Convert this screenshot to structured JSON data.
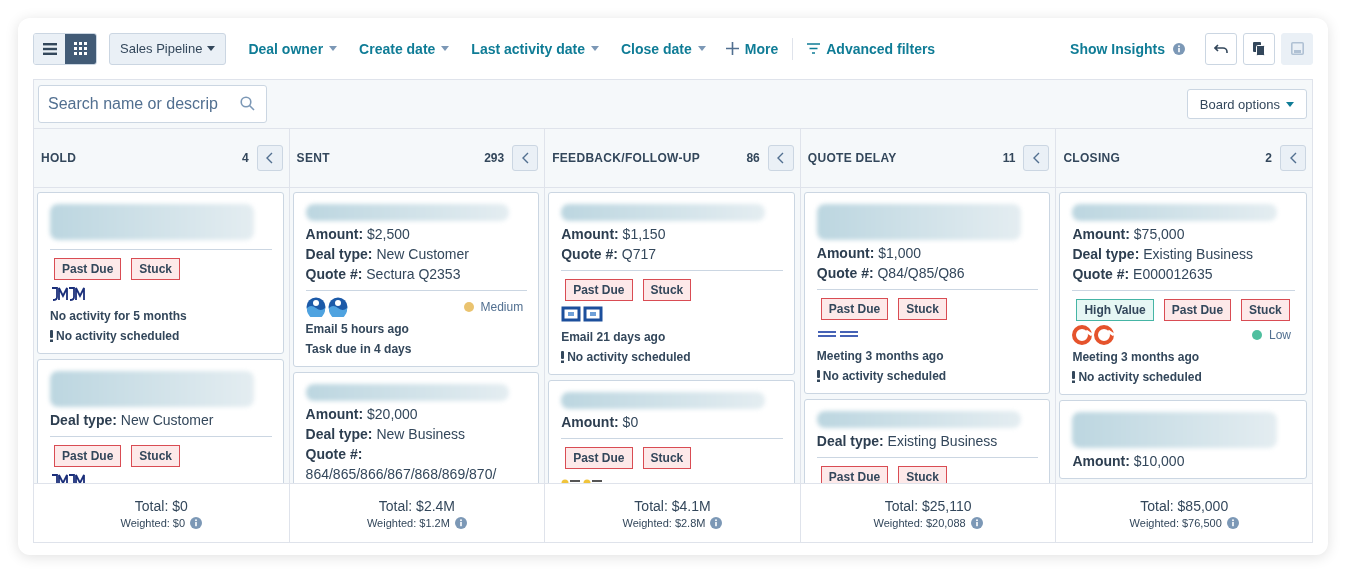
{
  "toolbar": {
    "views": [
      {
        "kind": "list",
        "selected": false
      },
      {
        "kind": "grid",
        "selected": true
      }
    ],
    "pipeline": "Sales Pipeline",
    "filters": [
      "Deal owner",
      "Create date",
      "Last activity date",
      "Close date"
    ],
    "more": "More",
    "advanced_filters": "Advanced filters",
    "insights": "Show Insights",
    "actions": [
      {
        "kind": "undo",
        "disabled": false
      },
      {
        "kind": "copy",
        "disabled": false
      },
      {
        "kind": "save",
        "disabled": true
      }
    ]
  },
  "search": {
    "placeholder": "Search name or descrip"
  },
  "board_options": "Board options",
  "columns": [
    {
      "name": "HOLD",
      "count": "4",
      "cards": [
        {
          "title": {
            "kind": "double"
          },
          "tags": [
            {
              "label": "Past Due",
              "kind": "alert"
            },
            {
              "label": "Stuck",
              "kind": "alert"
            }
          ],
          "logos": [
            {
              "kind": "monogram"
            }
          ],
          "activities": [
            {
              "text": "No activity for 5 months",
              "alert": false
            },
            {
              "text": "No activity scheduled",
              "alert": true
            }
          ]
        },
        {
          "title": {
            "kind": "double"
          },
          "fields": [
            "**Deal type:** New Customer"
          ],
          "tags": [
            {
              "label": "Past Due",
              "kind": "alert"
            },
            {
              "label": "Stuck",
              "kind": "alert"
            }
          ],
          "logos": [
            {
              "kind": "monogram"
            }
          ]
        }
      ],
      "total": "Total: $0",
      "weighted": "Weighted: $0"
    },
    {
      "name": "SENT",
      "count": "293",
      "cards": [
        {
          "title": {
            "kind": "single"
          },
          "fields": [
            "**Amount:** $2,500",
            "**Deal type:** New Customer",
            "**Quote #:** Sectura Q2353"
          ],
          "logos": [
            {
              "kind": "emblem"
            },
            {
              "kind": "emblem"
            }
          ],
          "priority": {
            "label": "Medium",
            "color": "#eac36f"
          },
          "activities": [
            {
              "text": "Email 5 hours ago",
              "alert": false
            },
            {
              "text": "Task due in 4 days",
              "alert": false
            }
          ]
        },
        {
          "title": {
            "kind": "single"
          },
          "fields": [
            "**Amount:** $20,000",
            "**Deal type:** New Business",
            "**Quote #:** 864/865/866/867/868/869/870/"
          ]
        }
      ],
      "total": "Total: $2.4M",
      "weighted": "Weighted: $1.2M"
    },
    {
      "name": "FEEDBACK/FOLLOW-UP",
      "count": "86",
      "cards": [
        {
          "title": {
            "kind": "single"
          },
          "fields": [
            "**Amount:** $1,150",
            "**Quote #:** Q717"
          ],
          "tags": [
            {
              "label": "Past Due",
              "kind": "alert"
            },
            {
              "label": "Stuck",
              "kind": "alert"
            }
          ],
          "logos": [
            {
              "kind": "frame"
            },
            {
              "kind": "frame"
            }
          ],
          "activities": [
            {
              "text": "Email 21 days ago",
              "alert": false
            },
            {
              "text": "No activity scheduled",
              "alert": true
            }
          ]
        },
        {
          "title": {
            "kind": "single"
          },
          "fields": [
            "**Amount:** $0"
          ],
          "tags": [
            {
              "label": "Past Due",
              "kind": "alert"
            },
            {
              "label": "Stuck",
              "kind": "alert"
            }
          ],
          "logos": [
            {
              "kind": "dot-mark"
            },
            {
              "kind": "dot-mark"
            }
          ]
        }
      ],
      "total": "Total: $4.1M",
      "weighted": "Weighted: $2.8M"
    },
    {
      "name": "QUOTE DELAY",
      "count": "11",
      "cards": [
        {
          "title": {
            "kind": "double"
          },
          "fields": [
            "**Amount:** $1,000",
            "**Quote #:** Q84/Q85/Q86"
          ],
          "tags": [
            {
              "label": "Past Due",
              "kind": "alert"
            },
            {
              "label": "Stuck",
              "kind": "alert"
            }
          ],
          "logos": [
            {
              "kind": "wordmark"
            },
            {
              "kind": "wordmark"
            }
          ],
          "activities": [
            {
              "text": "Meeting 3 months ago",
              "alert": false
            },
            {
              "text": "No activity scheduled",
              "alert": true
            }
          ]
        },
        {
          "title": {
            "kind": "single"
          },
          "fields": [
            "**Deal type:** Existing Business"
          ],
          "tags": [
            {
              "label": "Past Due",
              "kind": "alert"
            },
            {
              "label": "Stuck",
              "kind": "alert"
            }
          ]
        }
      ],
      "total": "Total: $25,110",
      "weighted": "Weighted: $20,088"
    },
    {
      "name": "CLOSING",
      "count": "2",
      "cards": [
        {
          "title": {
            "kind": "single"
          },
          "fields": [
            "**Amount:** $75,000",
            "**Deal type:** Existing Business",
            "**Quote #:** E000012635"
          ],
          "tags": [
            {
              "label": "High Value",
              "kind": "positive"
            },
            {
              "label": "Past Due",
              "kind": "alert"
            },
            {
              "label": "Stuck",
              "kind": "alert"
            }
          ],
          "logos": [
            {
              "kind": "ring"
            },
            {
              "kind": "ring"
            }
          ],
          "priority": {
            "label": "Low",
            "color": "#4fbf9f"
          },
          "activities": [
            {
              "text": "Meeting 3 months ago",
              "alert": false
            },
            {
              "text": "No activity scheduled",
              "alert": true
            }
          ]
        },
        {
          "title": {
            "kind": "double"
          },
          "fields": [
            "**Amount:** $10,000"
          ]
        }
      ],
      "total": "Total: $85,000",
      "weighted": "Weighted: $76,500"
    }
  ]
}
